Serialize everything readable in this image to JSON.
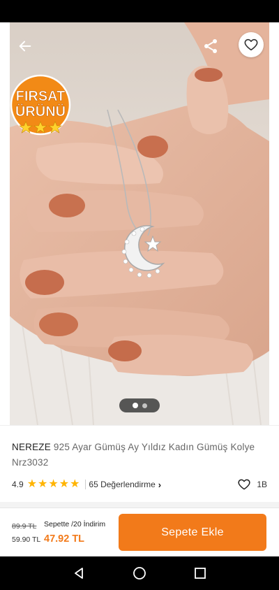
{
  "product": {
    "brand": "NEREZE",
    "name": "925 Ayar Gümüş Ay Yıldız Kadın Gümüş Kolye Nrz3032"
  },
  "badge": {
    "line1": "FIRSAT",
    "line2": "ÜRÜNÜ"
  },
  "gallery": {
    "image_count": 2,
    "active_index": 0
  },
  "rating": {
    "score": "4.9",
    "stars": 5,
    "reviews_label": "65 Değerlendirme",
    "likes": "1B"
  },
  "pricing": {
    "old_price": "89.9 TL",
    "list_price": "59.90 TL",
    "promo_label": "Sepette /20 İndirim",
    "promo_price": "47.92 TL"
  },
  "actions": {
    "add_to_cart": "Sepete Ekle"
  },
  "colors": {
    "accent": "#f27a1a",
    "star": "#ffb400",
    "badge_orange": "#f28a16"
  },
  "icons": {
    "back": "arrow-left-icon",
    "share": "share-icon",
    "favorite": "heart-icon",
    "nav_back": "triangle-back-icon",
    "nav_home": "circle-home-icon",
    "nav_recent": "square-recent-icon"
  }
}
